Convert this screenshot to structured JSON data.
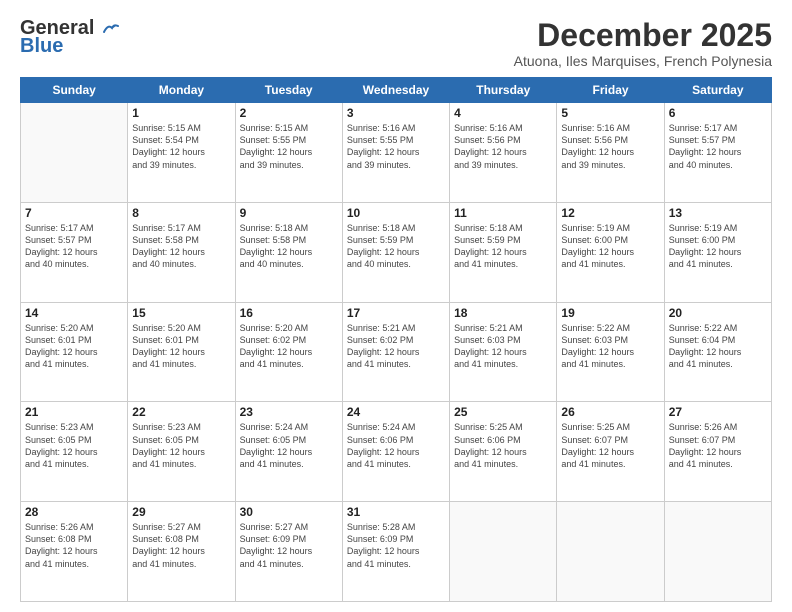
{
  "logo": {
    "line1": "General",
    "line2": "Blue"
  },
  "title": "December 2025",
  "subtitle": "Atuona, Iles Marquises, French Polynesia",
  "days_header": [
    "Sunday",
    "Monday",
    "Tuesday",
    "Wednesday",
    "Thursday",
    "Friday",
    "Saturday"
  ],
  "weeks": [
    [
      {
        "day": "",
        "info": ""
      },
      {
        "day": "1",
        "info": "Sunrise: 5:15 AM\nSunset: 5:54 PM\nDaylight: 12 hours\nand 39 minutes."
      },
      {
        "day": "2",
        "info": "Sunrise: 5:15 AM\nSunset: 5:55 PM\nDaylight: 12 hours\nand 39 minutes."
      },
      {
        "day": "3",
        "info": "Sunrise: 5:16 AM\nSunset: 5:55 PM\nDaylight: 12 hours\nand 39 minutes."
      },
      {
        "day": "4",
        "info": "Sunrise: 5:16 AM\nSunset: 5:56 PM\nDaylight: 12 hours\nand 39 minutes."
      },
      {
        "day": "5",
        "info": "Sunrise: 5:16 AM\nSunset: 5:56 PM\nDaylight: 12 hours\nand 39 minutes."
      },
      {
        "day": "6",
        "info": "Sunrise: 5:17 AM\nSunset: 5:57 PM\nDaylight: 12 hours\nand 40 minutes."
      }
    ],
    [
      {
        "day": "7",
        "info": "Sunrise: 5:17 AM\nSunset: 5:57 PM\nDaylight: 12 hours\nand 40 minutes."
      },
      {
        "day": "8",
        "info": "Sunrise: 5:17 AM\nSunset: 5:58 PM\nDaylight: 12 hours\nand 40 minutes."
      },
      {
        "day": "9",
        "info": "Sunrise: 5:18 AM\nSunset: 5:58 PM\nDaylight: 12 hours\nand 40 minutes."
      },
      {
        "day": "10",
        "info": "Sunrise: 5:18 AM\nSunset: 5:59 PM\nDaylight: 12 hours\nand 40 minutes."
      },
      {
        "day": "11",
        "info": "Sunrise: 5:18 AM\nSunset: 5:59 PM\nDaylight: 12 hours\nand 41 minutes."
      },
      {
        "day": "12",
        "info": "Sunrise: 5:19 AM\nSunset: 6:00 PM\nDaylight: 12 hours\nand 41 minutes."
      },
      {
        "day": "13",
        "info": "Sunrise: 5:19 AM\nSunset: 6:00 PM\nDaylight: 12 hours\nand 41 minutes."
      }
    ],
    [
      {
        "day": "14",
        "info": "Sunrise: 5:20 AM\nSunset: 6:01 PM\nDaylight: 12 hours\nand 41 minutes."
      },
      {
        "day": "15",
        "info": "Sunrise: 5:20 AM\nSunset: 6:01 PM\nDaylight: 12 hours\nand 41 minutes."
      },
      {
        "day": "16",
        "info": "Sunrise: 5:20 AM\nSunset: 6:02 PM\nDaylight: 12 hours\nand 41 minutes."
      },
      {
        "day": "17",
        "info": "Sunrise: 5:21 AM\nSunset: 6:02 PM\nDaylight: 12 hours\nand 41 minutes."
      },
      {
        "day": "18",
        "info": "Sunrise: 5:21 AM\nSunset: 6:03 PM\nDaylight: 12 hours\nand 41 minutes."
      },
      {
        "day": "19",
        "info": "Sunrise: 5:22 AM\nSunset: 6:03 PM\nDaylight: 12 hours\nand 41 minutes."
      },
      {
        "day": "20",
        "info": "Sunrise: 5:22 AM\nSunset: 6:04 PM\nDaylight: 12 hours\nand 41 minutes."
      }
    ],
    [
      {
        "day": "21",
        "info": "Sunrise: 5:23 AM\nSunset: 6:05 PM\nDaylight: 12 hours\nand 41 minutes."
      },
      {
        "day": "22",
        "info": "Sunrise: 5:23 AM\nSunset: 6:05 PM\nDaylight: 12 hours\nand 41 minutes."
      },
      {
        "day": "23",
        "info": "Sunrise: 5:24 AM\nSunset: 6:05 PM\nDaylight: 12 hours\nand 41 minutes."
      },
      {
        "day": "24",
        "info": "Sunrise: 5:24 AM\nSunset: 6:06 PM\nDaylight: 12 hours\nand 41 minutes."
      },
      {
        "day": "25",
        "info": "Sunrise: 5:25 AM\nSunset: 6:06 PM\nDaylight: 12 hours\nand 41 minutes."
      },
      {
        "day": "26",
        "info": "Sunrise: 5:25 AM\nSunset: 6:07 PM\nDaylight: 12 hours\nand 41 minutes."
      },
      {
        "day": "27",
        "info": "Sunrise: 5:26 AM\nSunset: 6:07 PM\nDaylight: 12 hours\nand 41 minutes."
      }
    ],
    [
      {
        "day": "28",
        "info": "Sunrise: 5:26 AM\nSunset: 6:08 PM\nDaylight: 12 hours\nand 41 minutes."
      },
      {
        "day": "29",
        "info": "Sunrise: 5:27 AM\nSunset: 6:08 PM\nDaylight: 12 hours\nand 41 minutes."
      },
      {
        "day": "30",
        "info": "Sunrise: 5:27 AM\nSunset: 6:09 PM\nDaylight: 12 hours\nand 41 minutes."
      },
      {
        "day": "31",
        "info": "Sunrise: 5:28 AM\nSunset: 6:09 PM\nDaylight: 12 hours\nand 41 minutes."
      },
      {
        "day": "",
        "info": ""
      },
      {
        "day": "",
        "info": ""
      },
      {
        "day": "",
        "info": ""
      }
    ]
  ]
}
